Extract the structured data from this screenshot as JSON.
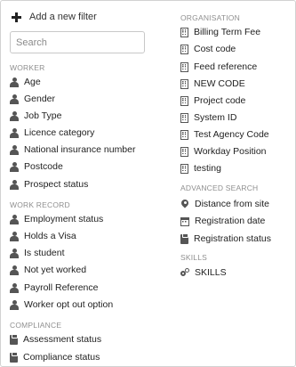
{
  "add_filter": {
    "label": "Add a new filter",
    "icon": "plus-icon"
  },
  "search": {
    "placeholder": "Search",
    "value": ""
  },
  "worker": {
    "heading": "WORKER",
    "items": [
      "Age",
      "Gender",
      "Job Type",
      "Licence category",
      "National insurance number",
      "Postcode",
      "Prospect status"
    ]
  },
  "work_record": {
    "heading": "WORK RECORD",
    "items": [
      "Employment status",
      "Holds a Visa",
      "Is student",
      "Not yet worked",
      "Payroll Reference",
      "Worker opt out option"
    ]
  },
  "compliance": {
    "heading": "COMPLIANCE",
    "items": [
      "Assessment status",
      "Compliance status"
    ]
  },
  "organisation": {
    "heading": "ORGANISATION",
    "items": [
      "Billing Term Fee",
      "Cost code",
      "Feed reference",
      "NEW CODE",
      "Project code",
      "System ID",
      "Test Agency Code",
      "Workday Position",
      "testing"
    ]
  },
  "advanced_search": {
    "heading": "ADVANCED SEARCH",
    "items": [
      "Distance from site",
      "Registration date",
      "Registration status"
    ]
  },
  "skills": {
    "heading": "SKILLS",
    "items": [
      "SKILLS"
    ]
  },
  "colors": {
    "text": "#222222",
    "section_heading": "#8f8f8f",
    "icon": "#555555",
    "border": "#d2d2d2"
  }
}
